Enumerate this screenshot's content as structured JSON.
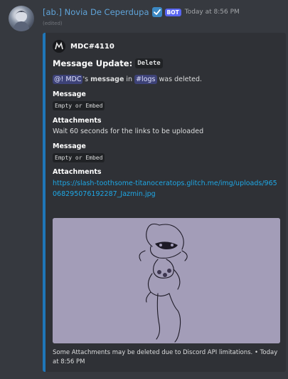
{
  "message": {
    "username": "[ab.] Novia De Ceperdupa",
    "bot_tag": "BOT",
    "timestamp": "Today at 8:56 PM",
    "edited": "(edited)"
  },
  "embed": {
    "author": "MDC#4110",
    "title_prefix": "Message Update:",
    "title_code": "Delete",
    "desc": {
      "mention_user": "@! MDC",
      "text1": "'s ",
      "word_message": "message",
      "text2": " in ",
      "mention_channel": "#logs",
      "text3": " was deleted."
    },
    "fields": [
      {
        "name": "Message",
        "value": "Empty or Embed"
      },
      {
        "name": "Attachments",
        "value": "Wait 60 seconds for the links to be uploaded"
      },
      {
        "name": "Message",
        "value": "Empty or Embed"
      },
      {
        "name": "Attachments",
        "value": "https://slash-toothsome-titanoceratops.glitch.me/img/uploads/965068295076192287_Jazmin.jpg"
      }
    ],
    "footer": "Some Attachments may be deleted due to Discord API limitations. • Today at 8:56 PM",
    "accent_color": "#1f76b8"
  },
  "icons": [
    "verified-icon",
    "avatar",
    "author-icon",
    "attachment-image"
  ]
}
